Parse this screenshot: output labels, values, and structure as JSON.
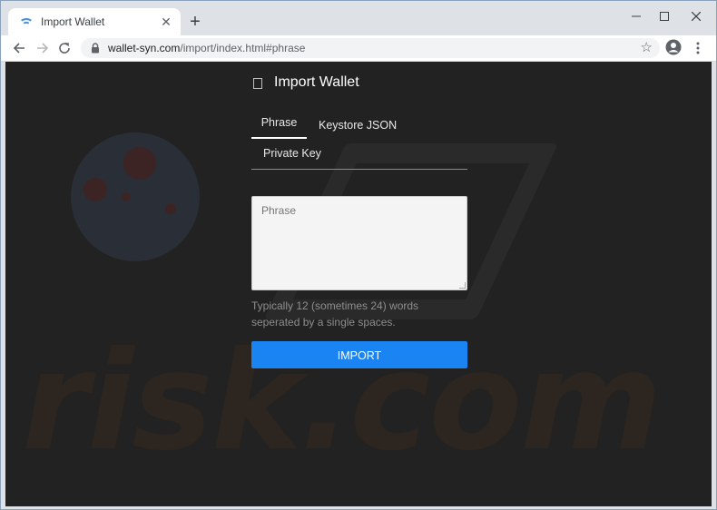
{
  "browser": {
    "tab_title": "Import Wallet",
    "url_domain": "wallet-syn.com",
    "url_path": "/import/index.html#phrase",
    "new_tab_symbol": "+",
    "close_tab_symbol": "✕",
    "icons": [
      "wallet-favicon-icon",
      "close-icon",
      "plus-icon",
      "minimize-icon",
      "maximize-icon",
      "close-window-icon",
      "back-arrow-icon",
      "forward-arrow-icon",
      "reload-icon",
      "lock-icon",
      "star-icon",
      "account-icon",
      "menu-icon"
    ]
  },
  "page": {
    "title": "Import Wallet",
    "tabs": [
      {
        "label": "Phrase",
        "active": true
      },
      {
        "label": "Keystore JSON",
        "active": false
      },
      {
        "label": "Private Key",
        "active": false
      }
    ],
    "phrase_placeholder": "Phrase",
    "hint": "Typically 12 (sometimes 24) words seperated by a single spaces.",
    "import_label": "IMPORT",
    "accent_color": "#1a84f2"
  },
  "watermark": {
    "text": "risk.com"
  }
}
